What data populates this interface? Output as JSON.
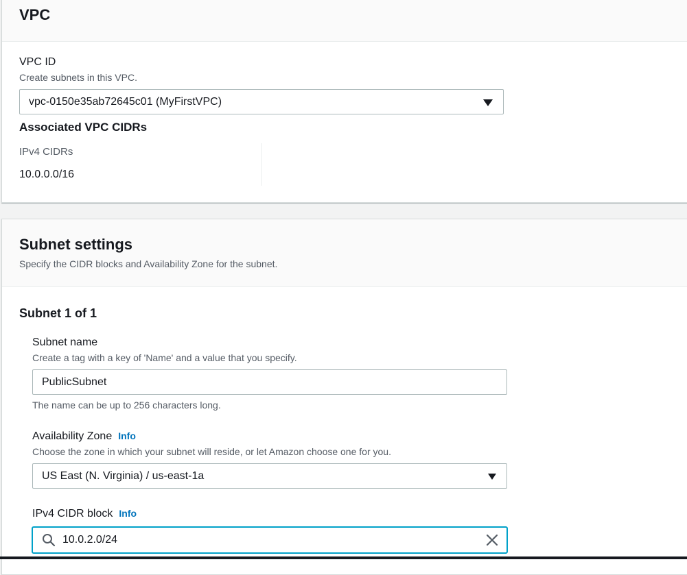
{
  "vpc_panel": {
    "title": "VPC",
    "vpc_id_label": "VPC ID",
    "vpc_id_description": "Create subnets in this VPC.",
    "vpc_select_value": "vpc-0150e35ab72645c01 (MyFirstVPC)",
    "associated_heading": "Associated VPC CIDRs",
    "ipv4_cidrs_label": "IPv4 CIDRs",
    "ipv4_cidrs_value": "10.0.0.0/16"
  },
  "subnet_panel": {
    "title": "Subnet settings",
    "description": "Specify the CIDR blocks and Availability Zone for the subnet.",
    "subnet_counter": "Subnet 1 of 1",
    "subnet_name": {
      "label": "Subnet name",
      "description": "Create a tag with a key of 'Name' and a value that you specify.",
      "value": "PublicSubnet",
      "constraint": "The name can be up to 256 characters long."
    },
    "availability_zone": {
      "label": "Availability Zone",
      "info": "Info",
      "description": "Choose the zone in which your subnet will reside, or let Amazon choose one for you.",
      "value": "US East (N. Virginia) / us-east-1a"
    },
    "ipv4_cidr_block": {
      "label": "IPv4 CIDR block",
      "info": "Info",
      "value": "10.0.2.0/24"
    }
  },
  "colors": {
    "link": "#0073bb",
    "focus_border": "#00a1c9",
    "text": "#16191f",
    "muted_text": "#545b64"
  },
  "icons": {
    "dropdown": "caret-down-icon",
    "search": "search-icon",
    "clear": "close-icon"
  }
}
